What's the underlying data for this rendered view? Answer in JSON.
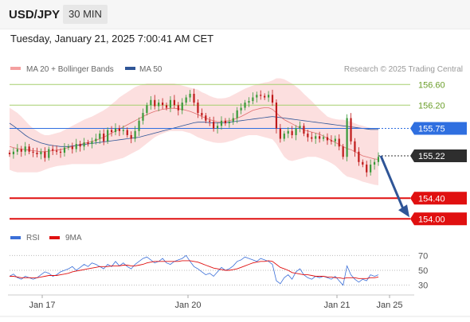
{
  "header": {
    "symbol": "USD/JPY",
    "timeframe": "30 MIN",
    "timestamp": "Tuesday, January 21, 2025 7:00:41 AM CET"
  },
  "chart_data": {
    "type": "candlestick",
    "legend": [
      {
        "name": "MA 20 + Bollinger Bands",
        "color": "#f4a0a0"
      },
      {
        "name": "MA 50",
        "color": "#2f5597"
      }
    ],
    "credit": "Research © 2025 Trading Central",
    "x_tick_labels": [
      "Jan 17",
      "Jan 20",
      "Jan 21",
      "Jan 25"
    ],
    "y_tick_labels": [
      "156.60",
      "156.20"
    ],
    "ylim": [
      153.85,
      156.82
    ],
    "resistance_lines": [
      156.6,
      156.2
    ],
    "pivot": {
      "label": "155.75",
      "value": 155.75,
      "color": "#2f6fe0"
    },
    "last_price": {
      "label": "155.22",
      "value": 155.22
    },
    "support_levels": [
      {
        "label": "154.40",
        "value": 154.4,
        "color": "#e01010"
      },
      {
        "label": "154.00",
        "value": 154.0,
        "color": "#e01010"
      }
    ],
    "forecast_arrow": {
      "from": 155.22,
      "to": 154.0,
      "color": "#2f5597"
    },
    "close": [
      155.25,
      155.3,
      155.35,
      155.3,
      155.4,
      155.3,
      155.28,
      155.25,
      155.3,
      155.18,
      155.35,
      155.32,
      155.3,
      155.28,
      155.38,
      155.4,
      155.35,
      155.45,
      155.4,
      155.48,
      155.45,
      155.5,
      155.55,
      155.65,
      155.5,
      155.72,
      155.68,
      155.75,
      155.7,
      155.72,
      155.62,
      155.55,
      155.7,
      155.9,
      156.05,
      156.2,
      156.3,
      156.18,
      156.25,
      156.2,
      156.15,
      156.3,
      156.2,
      156.1,
      156.25,
      156.35,
      156.42,
      156.25,
      156.05,
      156.0,
      155.9,
      155.88,
      155.75,
      155.8,
      155.9,
      155.85,
      155.88,
      155.95,
      156.1,
      156.15,
      156.25,
      156.28,
      156.35,
      156.4,
      156.38,
      156.35,
      156.4,
      156.25,
      155.75,
      155.55,
      155.65,
      155.7,
      155.62,
      155.75,
      155.8,
      155.65,
      155.58,
      155.55,
      155.6,
      155.55,
      155.58,
      155.52,
      155.5,
      155.55,
      155.4,
      155.2,
      155.95,
      155.5,
      155.3,
      155.1,
      155.05,
      154.9,
      155.05,
      155.1,
      155.2
    ],
    "ma20": [
      155.4,
      155.38,
      155.36,
      155.35,
      155.34,
      155.33,
      155.32,
      155.31,
      155.3,
      155.3,
      155.31,
      155.32,
      155.33,
      155.34,
      155.36,
      155.38,
      155.4,
      155.42,
      155.44,
      155.46,
      155.48,
      155.5,
      155.52,
      155.55,
      155.58,
      155.62,
      155.66,
      155.7,
      155.74,
      155.78,
      155.82,
      155.86,
      155.9,
      155.94,
      155.98,
      156.02,
      156.05,
      156.08,
      156.1,
      156.12,
      156.13,
      156.14,
      156.14,
      156.13,
      156.12,
      156.1,
      156.08,
      156.05,
      156.02,
      155.98,
      155.95,
      155.92,
      155.9,
      155.88,
      155.88,
      155.89,
      155.9,
      155.92,
      155.95,
      155.98,
      156.02,
      156.06,
      156.1,
      156.12,
      156.14,
      156.15,
      156.15,
      156.12,
      156.05,
      155.98,
      155.92,
      155.88,
      155.84,
      155.8,
      155.76,
      155.72,
      155.7,
      155.68,
      155.66,
      155.64,
      155.6,
      155.56,
      155.52,
      155.48,
      155.44,
      155.4,
      155.36,
      155.34,
      155.3,
      155.26,
      155.22,
      155.2,
      155.18,
      155.16,
      155.15
    ],
    "bb_upper": [
      156.15,
      156.1,
      156.05,
      155.98,
      155.9,
      155.82,
      155.75,
      155.7,
      155.65,
      155.62,
      155.62,
      155.64,
      155.66,
      155.68,
      155.72,
      155.76,
      155.8,
      155.84,
      155.88,
      155.92,
      155.95,
      155.98,
      156.02,
      156.06,
      156.1,
      156.15,
      156.22,
      156.28,
      156.35,
      156.4,
      156.45,
      156.5,
      156.55,
      156.58,
      156.6,
      156.62,
      156.62,
      156.62,
      156.62,
      156.62,
      156.62,
      156.62,
      156.62,
      156.6,
      156.58,
      156.56,
      156.54,
      156.52,
      156.5,
      156.45,
      156.42,
      156.38,
      156.35,
      156.33,
      156.33,
      156.34,
      156.36,
      156.4,
      156.44,
      156.48,
      156.52,
      156.55,
      156.58,
      156.6,
      156.62,
      156.64,
      156.65,
      156.68,
      156.72,
      156.72,
      156.7,
      156.66,
      156.62,
      156.56,
      156.5,
      156.42,
      156.35,
      156.28,
      156.2,
      156.12,
      156.05,
      155.98,
      155.95,
      155.93,
      155.92,
      155.92,
      155.9,
      155.88,
      155.85,
      155.82,
      155.8,
      155.78,
      155.76,
      155.74,
      155.72
    ],
    "bb_lower": [
      154.95,
      154.92,
      154.9,
      154.9,
      154.9,
      154.9,
      154.9,
      154.9,
      154.92,
      154.95,
      154.98,
      155.0,
      155.02,
      155.03,
      155.04,
      155.05,
      155.06,
      155.06,
      155.06,
      155.06,
      155.06,
      155.06,
      155.06,
      155.06,
      155.08,
      155.1,
      155.12,
      155.14,
      155.16,
      155.18,
      155.22,
      155.26,
      155.3,
      155.34,
      155.4,
      155.46,
      155.52,
      155.58,
      155.62,
      155.65,
      155.68,
      155.7,
      155.7,
      155.7,
      155.7,
      155.68,
      155.66,
      155.62,
      155.58,
      155.55,
      155.52,
      155.5,
      155.48,
      155.47,
      155.47,
      155.48,
      155.5,
      155.52,
      155.55,
      155.58,
      155.6,
      155.62,
      155.62,
      155.62,
      155.6,
      155.58,
      155.56,
      155.54,
      155.45,
      155.32,
      155.2,
      155.14,
      155.12,
      155.14,
      155.16,
      155.18,
      155.2,
      155.2,
      155.2,
      155.18,
      155.15,
      155.12,
      155.08,
      155.03,
      154.96,
      154.88,
      154.82,
      154.8,
      154.78,
      154.75,
      154.72,
      154.7,
      154.68,
      154.66,
      154.65
    ],
    "ma50": [
      155.85,
      155.8,
      155.74,
      155.68,
      155.62,
      155.57,
      155.53,
      155.5,
      155.47,
      155.45,
      155.43,
      155.42,
      155.41,
      155.4,
      155.4,
      155.4,
      155.41,
      155.42,
      155.43,
      155.44,
      155.45,
      155.46,
      155.47,
      155.48,
      155.49,
      155.5,
      155.51,
      155.52,
      155.53,
      155.54,
      155.55,
      155.56,
      155.57,
      155.58,
      155.6,
      155.62,
      155.64,
      155.66,
      155.68,
      155.7,
      155.72,
      155.74,
      155.76,
      155.78,
      155.8,
      155.82,
      155.84,
      155.86,
      155.87,
      155.87,
      155.87,
      155.86,
      155.86,
      155.86,
      155.86,
      155.86,
      155.87,
      155.88,
      155.89,
      155.9,
      155.91,
      155.92,
      155.93,
      155.94,
      155.95,
      155.96,
      155.97,
      155.98,
      155.97,
      155.96,
      155.95,
      155.94,
      155.93,
      155.92,
      155.91,
      155.9,
      155.89,
      155.88,
      155.87,
      155.86,
      155.85,
      155.84,
      155.83,
      155.82,
      155.81,
      155.8,
      155.79,
      155.78,
      155.77,
      155.76,
      155.75,
      155.74,
      155.73,
      155.73,
      155.73
    ]
  },
  "rsi_panel": {
    "legend": [
      {
        "name": "RSI",
        "color": "#3b6fd8"
      },
      {
        "name": "9MA",
        "color": "#e01010"
      }
    ],
    "y_tick_labels": [
      "70",
      "50",
      "30"
    ],
    "levels": [
      70,
      50,
      30
    ],
    "ylim": [
      20,
      80
    ],
    "rsi": [
      42,
      45,
      40,
      38,
      42,
      40,
      38,
      40,
      44,
      48,
      46,
      42,
      44,
      48,
      50,
      52,
      55,
      50,
      54,
      58,
      55,
      60,
      58,
      55,
      52,
      58,
      55,
      62,
      56,
      60,
      55,
      52,
      58,
      62,
      66,
      68,
      64,
      60,
      62,
      66,
      60,
      58,
      62,
      64,
      66,
      70,
      62,
      55,
      52,
      48,
      44,
      46,
      42,
      48,
      54,
      50,
      52,
      56,
      62,
      64,
      68,
      66,
      64,
      62,
      66,
      64,
      62,
      58,
      36,
      32,
      40,
      44,
      38,
      48,
      52,
      44,
      40,
      38,
      42,
      40,
      42,
      40,
      38,
      42,
      36,
      30,
      56,
      44,
      38,
      34,
      38,
      36,
      44,
      42,
      44
    ],
    "ma9": [
      42,
      42,
      41,
      40,
      40,
      40,
      40,
      40,
      41,
      42,
      43,
      43,
      43,
      44,
      45,
      46,
      48,
      49,
      50,
      51,
      52,
      53,
      54,
      55,
      55,
      55,
      56,
      56,
      56,
      57,
      57,
      56,
      56,
      57,
      58,
      60,
      61,
      62,
      62,
      62,
      62,
      62,
      62,
      62,
      63,
      63,
      63,
      62,
      61,
      59,
      57,
      55,
      53,
      52,
      51,
      50,
      50,
      51,
      52,
      54,
      56,
      58,
      60,
      61,
      62,
      62,
      63,
      62,
      58,
      54,
      52,
      50,
      47,
      46,
      45,
      44,
      44,
      43,
      42,
      42,
      42,
      41,
      41,
      40,
      40,
      39,
      40,
      40,
      40,
      39,
      39,
      39,
      40,
      40,
      41
    ]
  }
}
